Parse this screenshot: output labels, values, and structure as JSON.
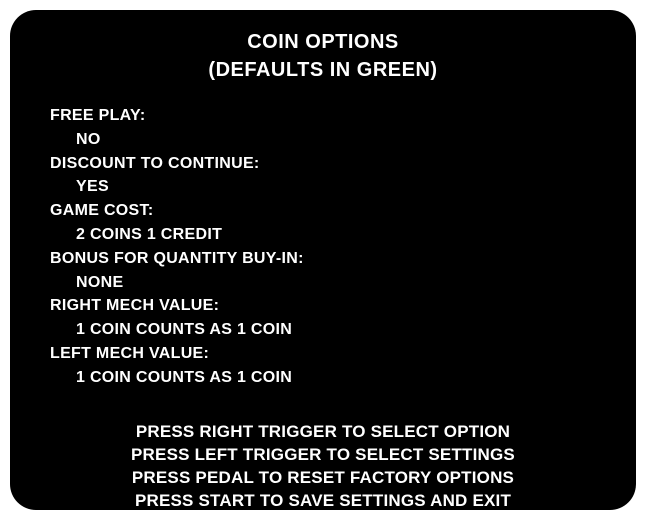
{
  "screen": {
    "title_line1": "COIN OPTIONS",
    "title_line2": "(DEFAULTS IN GREEN)"
  },
  "options": [
    {
      "label": "FREE PLAY:",
      "value": "NO"
    },
    {
      "label": "DISCOUNT TO CONTINUE:",
      "value": "YES"
    },
    {
      "label": "GAME COST:",
      "value": "2 COINS 1 CREDIT"
    },
    {
      "label": "BONUS FOR QUANTITY BUY-IN:",
      "value": "NONE"
    },
    {
      "label": "RIGHT MECH VALUE:",
      "value": "1 COIN COUNTS AS 1 COIN"
    },
    {
      "label": "LEFT MECH VALUE:",
      "value": "1 COIN COUNTS AS 1 COIN"
    }
  ],
  "instructions": [
    "PRESS RIGHT TRIGGER TO SELECT OPTION",
    "PRESS LEFT TRIGGER TO SELECT SETTINGS",
    "PRESS PEDAL TO RESET FACTORY OPTIONS",
    "PRESS START TO SAVE SETTINGS AND EXIT"
  ],
  "colors": {
    "screen_background": "#000000",
    "text": "#ffffff",
    "page_background": "#ffffff"
  }
}
